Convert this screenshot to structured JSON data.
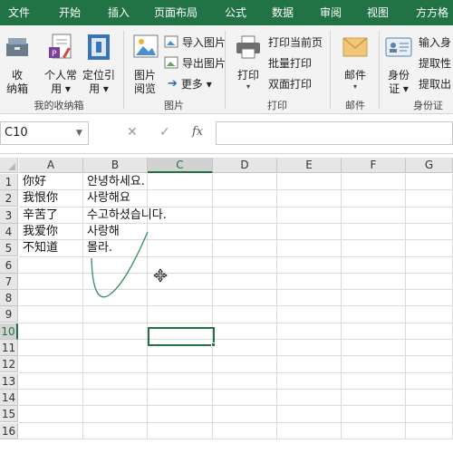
{
  "tabs": [
    "文件",
    "开始",
    "插入",
    "页面布局",
    "公式",
    "数据",
    "审阅",
    "视图",
    "方方格"
  ],
  "ribbon": {
    "favorites": {
      "group_label": "我的收纳箱",
      "storage_box": [
        "收",
        "纳箱"
      ],
      "personal_common": [
        "个人常",
        "用 ▾"
      ],
      "locate_ref": [
        "定位引",
        "用 ▾"
      ]
    },
    "image": {
      "group_label": "图片",
      "image_browse": [
        "图片",
        "阅览"
      ],
      "import_images": "导入图片",
      "export_images": "导出图片",
      "more": "更多 ▾"
    },
    "print": {
      "group_label": "打印",
      "print_button": [
        "打印",
        "▾"
      ],
      "print_current_page": "打印当前页",
      "batch_print": "批量打印",
      "duplex_print": "双面打印"
    },
    "mail": {
      "group_label": "邮件",
      "mail_button": [
        "邮件",
        "▾"
      ]
    },
    "id_card": {
      "group_label": "身份证",
      "id_button": [
        "身份",
        "证 ▾"
      ],
      "input_id": "输入身",
      "extract_gender": "提取性",
      "extract_birth": "提取出"
    }
  },
  "formula_bar": {
    "name_box": "C10",
    "cancel": "✕",
    "enter": "✓",
    "fx": "fx",
    "formula": ""
  },
  "sheet": {
    "columns": [
      "A",
      "B",
      "C",
      "D",
      "E",
      "F",
      "G"
    ],
    "selected_column": "C",
    "rows": [
      "1",
      "2",
      "3",
      "4",
      "5",
      "6",
      "7",
      "8",
      "9",
      "10",
      "11",
      "12",
      "13",
      "14",
      "15",
      "16"
    ],
    "selected_row": "10",
    "cells": {
      "A1": "你好",
      "B1": "안녕하세요.",
      "A2": "我恨你",
      "B2": "사랑해요",
      "A3": "辛苦了",
      "B3": "수고하셨습니다.",
      "A4": "我爱你",
      "B4": "사랑해",
      "A5": "不知道",
      "B5": "몰라."
    }
  },
  "colors": {
    "accent": "#217346",
    "ribbon_bg": "#f3f3f3",
    "header_bg": "#e6e6e6",
    "gridline": "#dadada"
  },
  "icons": [
    "storage-box-icon",
    "personal-common-icon",
    "locate-ref-icon",
    "image-browse-icon",
    "import-images-icon",
    "export-images-icon",
    "more-arrow-icon",
    "printer-icon",
    "print-page-icon",
    "batch-print-icon",
    "duplex-print-icon",
    "mail-icon",
    "id-card-icon",
    "input-id-icon",
    "extract-gender-icon",
    "extract-birth-icon",
    "cancel-icon",
    "enter-icon",
    "fx-icon",
    "move-cursor-icon"
  ]
}
